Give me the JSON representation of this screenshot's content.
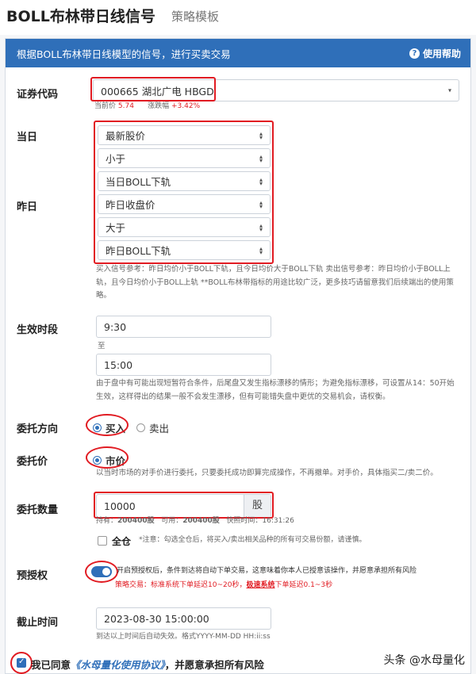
{
  "header": {
    "title": "BOLL布林带日线信号",
    "subtitle": "策略模板"
  },
  "banner": {
    "text": "根据BOLL布林带日线模型的信号，进行买卖交易",
    "help_label": "使用帮助",
    "help_icon": "question-circle-icon"
  },
  "security": {
    "label": "证券代码",
    "value": "000665 湖北广电 HBGD",
    "price_label": "当前价",
    "price": "5.74",
    "change_label": "涨跌幅",
    "change": "+3.42%"
  },
  "today": {
    "label": "当日",
    "selects": [
      "最新股价",
      "小于",
      "当日BOLL下轨"
    ]
  },
  "yesterday": {
    "label": "昨日",
    "selects": [
      "昨日收盘价",
      "大于",
      "昨日BOLL下轨"
    ]
  },
  "signal_note": "买入信号参考：昨日均价小于BOLL下轨，且今日均价大于BOLL下轨 卖出信号参考：昨日均价小于BOLL上轨，且今日均价小于BOLL上轨 **BOLL布林带指标的用途比较广泛，更多技巧请留意我们后续端出的使用策略。",
  "effective_time": {
    "label": "生效时段",
    "start": "9:30",
    "to": "至",
    "end": "15:00",
    "note": "由于盘中有可能出现短暂符合条件，后尾盘又发生指标漂移的情形；为避免指标漂移，可设置从14：50开始生效，这样得出的结果一般不会发生漂移，但有可能错失盘中更优的交易机会，请权衡。"
  },
  "direction": {
    "label": "委托方向",
    "options": [
      "买入",
      "卖出"
    ],
    "selected": "买入"
  },
  "price_type": {
    "label": "委托价",
    "option": "市价",
    "note": "以当时市场的对手价进行委托，只要委托成功即算完成操作，不再撤单。对手价，具体指买二/卖二价。"
  },
  "quantity": {
    "label": "委托数量",
    "value": "10000",
    "unit": "股",
    "holding_label": "持有：",
    "holding": "200400股",
    "available_label": "可用：",
    "available": "200400股",
    "quote_time_label": "快照时间：",
    "quote_time": "16:31:26",
    "all_label": "全仓",
    "all_note": "*注意：勾选全仓后，将买入/卖出相关品种的所有可交易份额，请谨慎。"
  },
  "preauth": {
    "label": "预授权",
    "enabled": true,
    "text": "开启预授权后，条件到达将自动下单交易，这意味着你本人已授意该操作，并愿意承担所有风险",
    "strategy_prefix": "策略交易：",
    "standard": "标准系统下单延迟10~20秒，",
    "fast_link": "极速系统",
    "fast": "下单延迟0.1~3秒"
  },
  "deadline": {
    "label": "截止时间",
    "value": "2023-08-30 15:00:00",
    "note": "到达以上时间后自动失效。格式YYYY-MM-DD HH:ii:ss"
  },
  "agreement": {
    "prefix": "我已同意",
    "link": "《水母量化使用协议》",
    "suffix": "，并愿意承担所有风险"
  },
  "watermark": "头条 @水母量化",
  "colors": {
    "accent": "#2f6fb9",
    "highlight": "#e11b22"
  }
}
